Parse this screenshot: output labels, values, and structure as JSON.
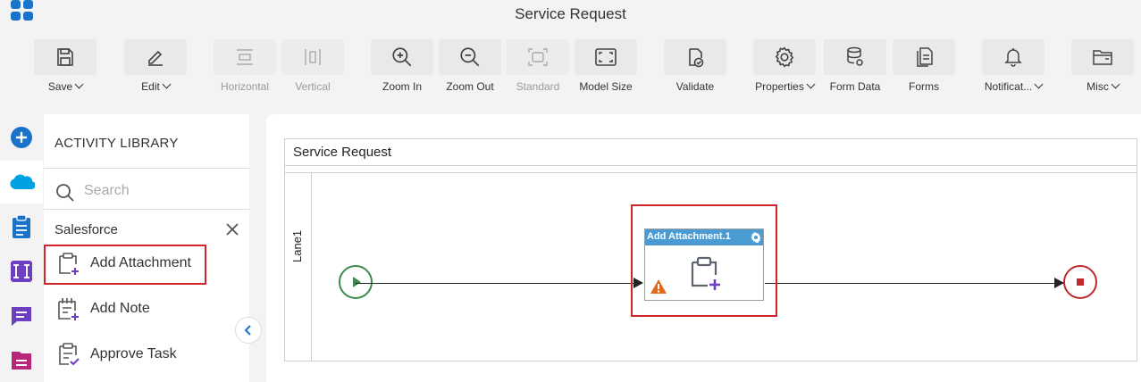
{
  "app": {
    "title": "Service Request"
  },
  "toolbar": {
    "buttons": [
      {
        "label": "Save",
        "icon": "save-icon",
        "dropdown": true,
        "enabled": true
      },
      {
        "label": "Edit",
        "icon": "pencil-icon",
        "dropdown": true,
        "enabled": true
      },
      {
        "label": "Horizontal",
        "icon": "horizontal-align-icon",
        "dropdown": false,
        "enabled": false
      },
      {
        "label": "Vertical",
        "icon": "vertical-align-icon",
        "dropdown": false,
        "enabled": false
      },
      {
        "label": "Zoom In",
        "icon": "zoom-in-icon",
        "dropdown": false,
        "enabled": true
      },
      {
        "label": "Zoom Out",
        "icon": "zoom-out-icon",
        "dropdown": false,
        "enabled": true
      },
      {
        "label": "Standard",
        "icon": "standard-size-icon",
        "dropdown": false,
        "enabled": false
      },
      {
        "label": "Model Size",
        "icon": "fit-screen-icon",
        "dropdown": false,
        "enabled": true
      },
      {
        "label": "Validate",
        "icon": "validate-icon",
        "dropdown": false,
        "enabled": true
      },
      {
        "label": "Properties",
        "icon": "gear-icon",
        "dropdown": true,
        "enabled": true
      },
      {
        "label": "Form Data",
        "icon": "database-icon",
        "dropdown": false,
        "enabled": true
      },
      {
        "label": "Forms",
        "icon": "forms-icon",
        "dropdown": false,
        "enabled": true
      },
      {
        "label": "Notificat...",
        "icon": "bell-icon",
        "dropdown": true,
        "enabled": true
      },
      {
        "label": "Misc",
        "icon": "folder-icon",
        "dropdown": true,
        "enabled": true
      }
    ]
  },
  "library": {
    "title": "ACTIVITY LIBRARY",
    "search_placeholder": "Search",
    "category": "Salesforce",
    "items": [
      {
        "label": "Add Attachment",
        "icon": "add-attachment-icon"
      },
      {
        "label": "Add Note",
        "icon": "add-note-icon"
      },
      {
        "label": "Approve Task",
        "icon": "approve-task-icon"
      }
    ]
  },
  "canvas": {
    "pool_title": "Service Request",
    "lane_label": "Lane1",
    "task": {
      "title": "Add Attachment.1",
      "icon": "add-attachment-icon",
      "has_warning": true
    }
  },
  "colors": {
    "accent_blue": "#1a73c9",
    "salesforce_blue": "#00a1e0",
    "purple": "#6b3fbf",
    "magenta": "#b8267a",
    "highlight_red": "#d2232a",
    "start_green": "#3a8c4a",
    "end_red": "#c0282d",
    "task_header": "#4a9bd1"
  }
}
